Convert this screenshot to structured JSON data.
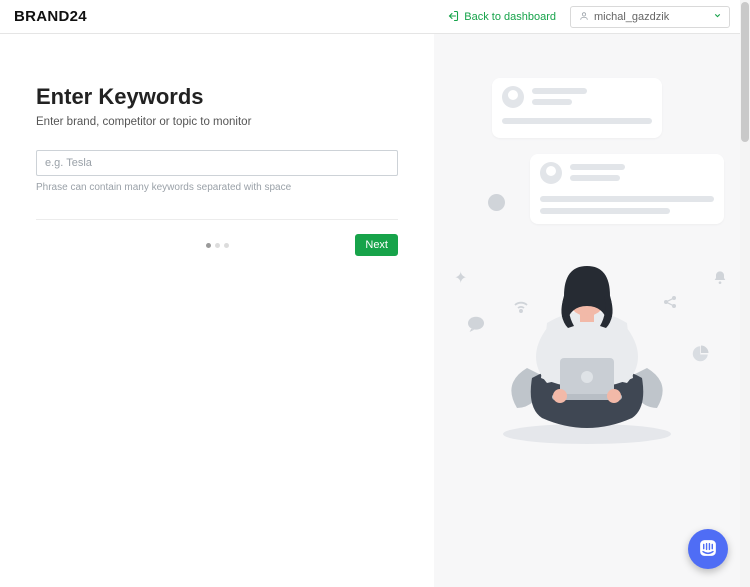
{
  "header": {
    "brand": "BRAND24",
    "back_label": "Back to dashboard",
    "username": "michal_gazdzik"
  },
  "wizard": {
    "title": "Enter Keywords",
    "subtitle": "Enter brand, competitor or topic to monitor",
    "input_placeholder": "e.g. Tesla",
    "input_value": "",
    "help_text": "Phrase can contain many keywords separated with space",
    "step_active": 1,
    "step_count": 3,
    "next_label": "Next"
  }
}
